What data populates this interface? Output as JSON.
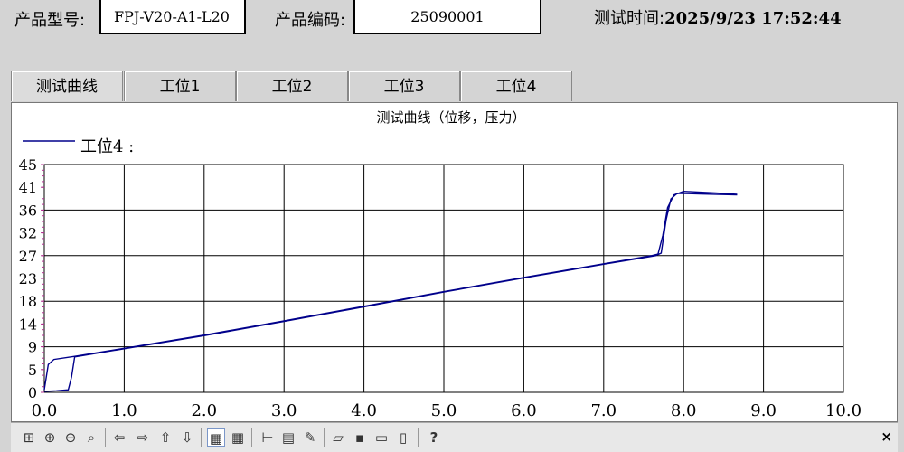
{
  "header": {
    "model_label": "产品型号:",
    "model_value": "FPJ-V20-A1-L20",
    "code_label": "产品编码:",
    "code_value": "25090001",
    "time_label": "测试时间:",
    "time_value": "2025/9/23 17:52:44"
  },
  "tabs": [
    {
      "label": "测试曲线"
    },
    {
      "label": "工位1"
    },
    {
      "label": "工位2"
    },
    {
      "label": "工位3"
    },
    {
      "label": "工位4"
    }
  ],
  "toolbar": {
    "icons": [
      "zoom-box-icon",
      "zoom-in-icon",
      "zoom-out-icon",
      "zoom-reset-icon",
      "pan-left-icon",
      "pan-right-icon",
      "pan-up-icon",
      "pan-down-icon",
      "chart-icon",
      "grid-table-icon",
      "axis-icon",
      "properties-icon",
      "edit-icon",
      "open-folder-icon",
      "save-icon",
      "print-icon",
      "print-preview-icon",
      "help-icon",
      "close-icon"
    ],
    "close_label": "×",
    "help_label": "?"
  },
  "chart_data": {
    "type": "line",
    "title": "测试曲线（位移，压力）",
    "legend": {
      "entry": "工位4 :",
      "placement": "top-left",
      "color": "#00008b"
    },
    "xlim": [
      0,
      10
    ],
    "ylim": [
      0,
      45
    ],
    "x_ticks": [
      "0.0",
      "1.0",
      "2.0",
      "3.0",
      "4.0",
      "5.0",
      "6.0",
      "7.0",
      "8.0",
      "9.0",
      "10.0"
    ],
    "y_ticks": [
      "0",
      "5",
      "9",
      "14",
      "18",
      "23",
      "27",
      "32",
      "36",
      "41",
      "45"
    ],
    "grid": true,
    "series": [
      {
        "name": "工位4 :",
        "color": "#00008b",
        "points": [
          [
            0.0,
            0.2
          ],
          [
            0.15,
            0.3
          ],
          [
            0.3,
            0.5
          ],
          [
            0.34,
            3.0
          ],
          [
            0.38,
            7.0
          ],
          [
            0.5,
            7.3
          ],
          [
            1.0,
            8.6
          ],
          [
            2.0,
            11.2
          ],
          [
            3.0,
            14.0
          ],
          [
            4.0,
            16.9
          ],
          [
            5.0,
            19.8
          ],
          [
            6.0,
            22.6
          ],
          [
            7.0,
            25.3
          ],
          [
            7.5,
            26.6
          ],
          [
            7.65,
            27.0
          ],
          [
            7.72,
            27.5
          ],
          [
            7.78,
            34.0
          ],
          [
            7.84,
            38.2
          ],
          [
            7.92,
            39.3
          ],
          [
            8.2,
            39.2
          ],
          [
            8.67,
            39.0
          ]
        ]
      },
      {
        "name": "",
        "color": "#00008b",
        "points": [
          [
            0.0,
            0.5
          ],
          [
            0.05,
            5.5
          ],
          [
            0.12,
            6.5
          ],
          [
            0.38,
            7.1
          ],
          [
            1.0,
            8.7
          ],
          [
            2.0,
            11.3
          ],
          [
            3.0,
            14.1
          ],
          [
            4.0,
            17.0
          ],
          [
            5.0,
            19.9
          ],
          [
            6.0,
            22.7
          ],
          [
            7.0,
            25.4
          ],
          [
            7.6,
            27.0
          ],
          [
            7.68,
            27.3
          ],
          [
            7.74,
            31.0
          ],
          [
            7.8,
            36.5
          ],
          [
            7.88,
            39.0
          ],
          [
            8.0,
            39.7
          ],
          [
            8.4,
            39.4
          ],
          [
            8.67,
            39.1
          ]
        ]
      }
    ]
  }
}
